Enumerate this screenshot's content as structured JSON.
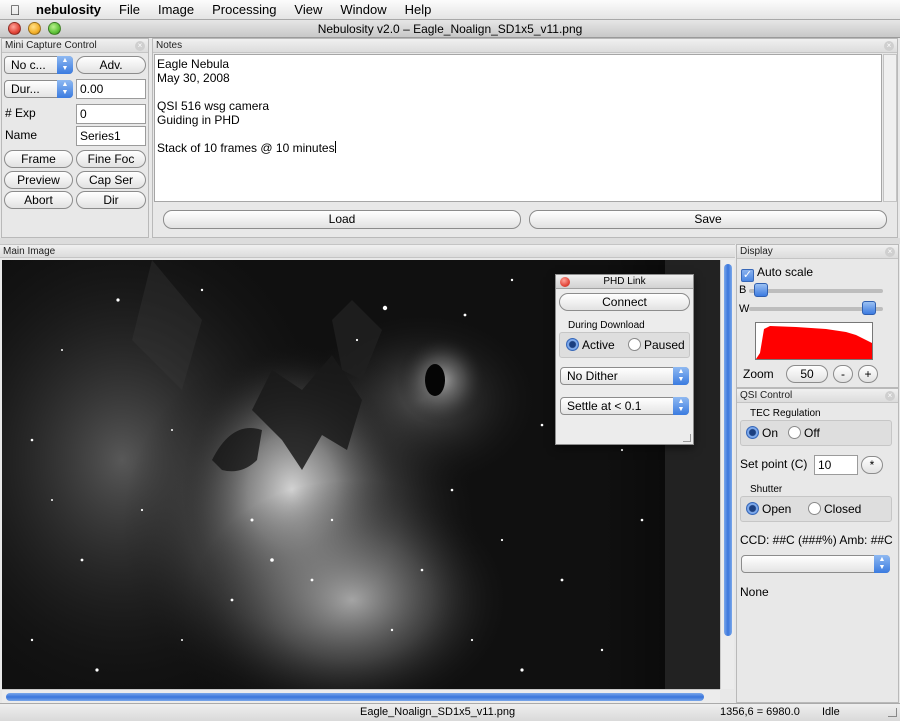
{
  "menubar": {
    "app": "nebulosity",
    "items": [
      "File",
      "Image",
      "Processing",
      "View",
      "Window",
      "Help"
    ]
  },
  "window": {
    "title": "Nebulosity v2.0 – Eagle_Noalign_SD1x5_v11.png"
  },
  "mini_capture": {
    "title": "Mini Capture Control",
    "camera_select": "No c...",
    "adv_button": "Adv.",
    "duration_select": "Dur...",
    "duration_value": "0.00",
    "exp_label": "# Exp",
    "exp_value": "0",
    "name_label": "Name",
    "name_value": "Series1",
    "buttons": {
      "frame": "Frame",
      "fine_focus": "Fine Foc",
      "preview": "Preview",
      "cap_series": "Cap Ser",
      "abort": "Abort",
      "dir": "Dir"
    }
  },
  "notes": {
    "title": "Notes",
    "lines": [
      "Eagle Nebula",
      "May 30, 2008",
      "",
      "QSI 516 wsg camera",
      "Guiding in PHD",
      "",
      "Stack of 10 frames @ 10 minutes"
    ],
    "load_button": "Load",
    "save_button": "Save"
  },
  "main_image": {
    "title": "Main Image"
  },
  "phd_link": {
    "title": "PHD Link",
    "connect_button": "Connect",
    "during_download_label": "During Download",
    "active_label": "Active",
    "paused_label": "Paused",
    "active_selected": true,
    "dither_select": "No Dither",
    "settle_select": "Settle at < 0.1"
  },
  "display": {
    "title": "Display",
    "auto_scale_label": "Auto scale",
    "auto_scale_checked": true,
    "b_label": "B",
    "w_label": "W",
    "b_slider_level": 0.04,
    "w_slider_level": 0.94,
    "zoom_label": "Zoom",
    "zoom_value": "50",
    "zoom_minus": "-",
    "zoom_plus": "+",
    "histogram_color": "#ff0000"
  },
  "qsi": {
    "title": "QSI Control",
    "tec_label": "TEC Regulation",
    "tec_on_label": "On",
    "tec_off_label": "Off",
    "tec_on_selected": true,
    "setpoint_label": "Set point (C)",
    "setpoint_value": "10",
    "setpoint_button": "*",
    "shutter_label": "Shutter",
    "shutter_open_label": "Open",
    "shutter_closed_label": "Closed",
    "shutter_open_selected": true,
    "ccd_readout": "CCD: ##C (###%) Amb: ##C",
    "status_text": "None"
  },
  "statusbar": {
    "filename": "Eagle_Noalign_SD1x5_v11.png",
    "pixel_readout": "1356,6 = 6980.0",
    "state": "Idle"
  },
  "colors": {
    "accent": "#3b7be0",
    "histogram": "#ff0000"
  }
}
